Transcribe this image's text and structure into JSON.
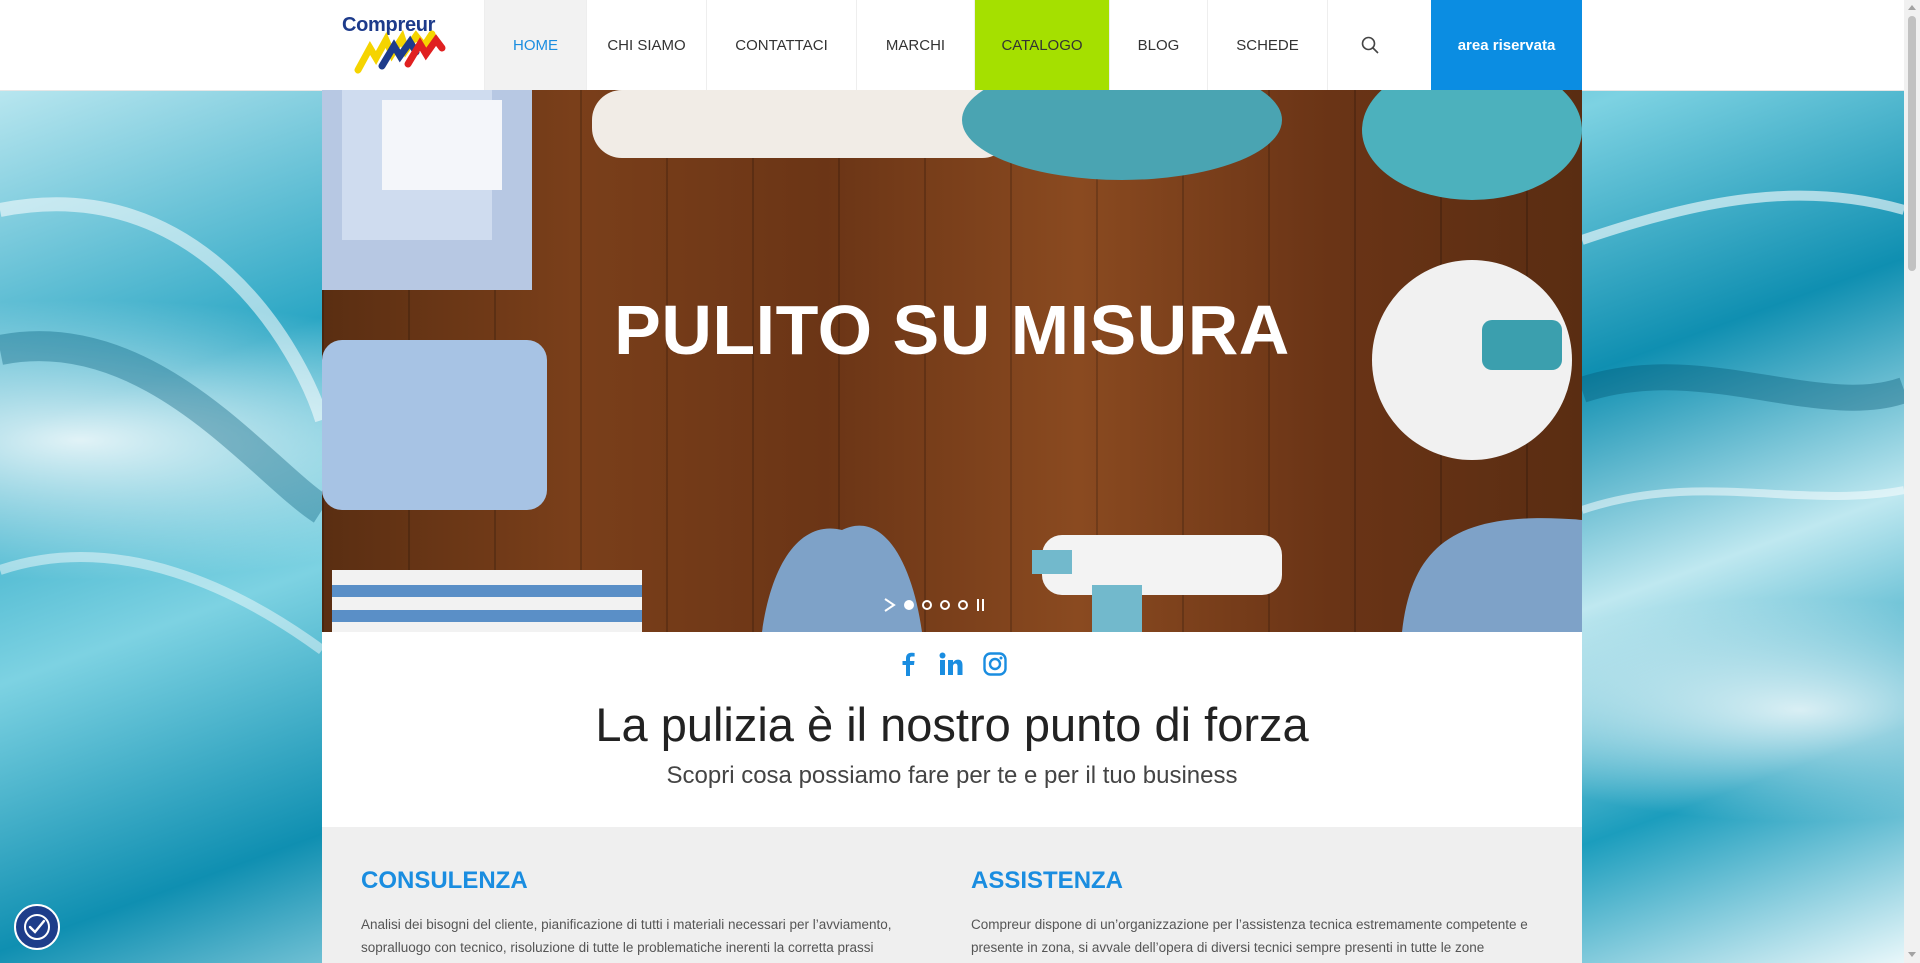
{
  "logo": {
    "text": "Compreur"
  },
  "nav": {
    "items": [
      {
        "label": "HOME"
      },
      {
        "label": "CHI SIAMO"
      },
      {
        "label": "CONTATTACI"
      },
      {
        "label": "MARCHI"
      },
      {
        "label": "CATALOGO"
      },
      {
        "label": "BLOG"
      },
      {
        "label": "SCHEDE"
      }
    ],
    "search_icon": "search-icon",
    "area_label": "area riservata"
  },
  "hero": {
    "title": "PULITO SU MISURA",
    "slides_count": 4,
    "active_slide": 1
  },
  "intro": {
    "headline": "La pulizia è il nostro punto di forza",
    "subline": "Scopri cosa possiamo fare per te e per il tuo business"
  },
  "social": [
    "facebook-icon",
    "linkedin-icon",
    "instagram-icon"
  ],
  "services": [
    {
      "title": "CONSULENZA",
      "text": "Analisi dei bisogni del cliente, pianificazione di tutti i materiali necessari per l’avviamento, sopralluogo con tecnico, risoluzione di tutte le problematiche inerenti la corretta prassi"
    },
    {
      "title": "ASSISTENZA",
      "text": "Compreur dispone di un’organizzazione per l’assistenza tecnica estremamente competente e presente in zona, si avvale dell’opera di diversi tecnici sempre presenti in tutte le zone"
    }
  ],
  "colors": {
    "brand_blue": "#1a8de0",
    "catalogo_green": "#a5e000",
    "area_blue": "#0b8de2"
  }
}
